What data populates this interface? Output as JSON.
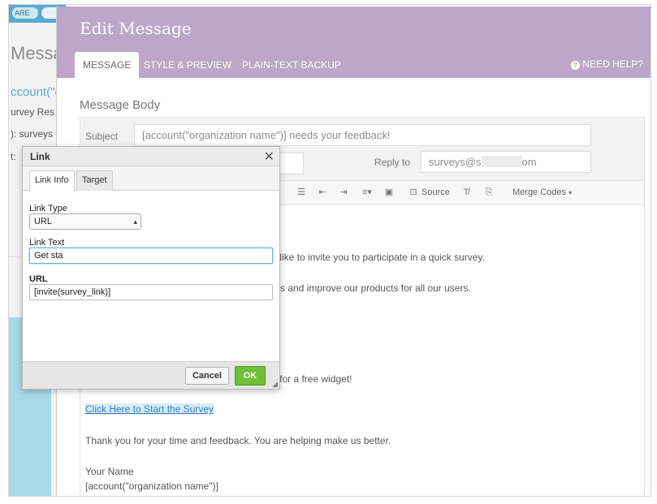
{
  "background": {
    "topbar_pill": "ARE",
    "heading": "Messa",
    "accent_line": "ccount(\"o",
    "line1": "urvey Res",
    "line2": "): surveys",
    "line3": "t:"
  },
  "modal": {
    "title": "Edit Message",
    "tabs": [
      {
        "label": "MESSAGE"
      },
      {
        "label": "STYLE & PREVIEW"
      },
      {
        "label": "PLAIN-TEXT BACKUP"
      }
    ],
    "help_label": "NEED HELP?",
    "section_title": "Message Body",
    "subject_label": "Subject",
    "subject_value": "[account(\"organization name\")] needs your feedback!",
    "reply_to_label": "Reply to",
    "reply_to_value_start": "surveys@s",
    "reply_to_value_end": "om"
  },
  "toolbar": {
    "source_label": "Source",
    "merge_codes_label": "Merge Codes"
  },
  "editor": {
    "line_invite": "uld like to invite you to participate in a quick survey.",
    "line_needs": "eeds and improve our products for all our users.",
    "line_dot": ".",
    "line_raffle": "ffle for a free widget!",
    "link_text": "Click Here to Start the Survey",
    "line_thanks": "Thank you for your time and feedback. You are helping make us better.",
    "signature_name": "Your Name",
    "signature_org": "[account(\"organization name\")]"
  },
  "link_dialog": {
    "title": "Link",
    "tabs": [
      {
        "label": "Link Info"
      },
      {
        "label": "Target"
      }
    ],
    "link_type_label": "Link Type",
    "link_type_value": "URL",
    "link_text_label": "Link Text",
    "link_text_value": "Get sta",
    "url_label": "URL",
    "url_value": "[invite(survey_link)]",
    "cancel_label": "Cancel",
    "ok_label": "OK"
  },
  "colors": {
    "header_purple": "#bca7c8",
    "ok_green": "#6fbf37",
    "link_blue": "#2e7fc0",
    "accent_blue": "#5aa9d0"
  }
}
